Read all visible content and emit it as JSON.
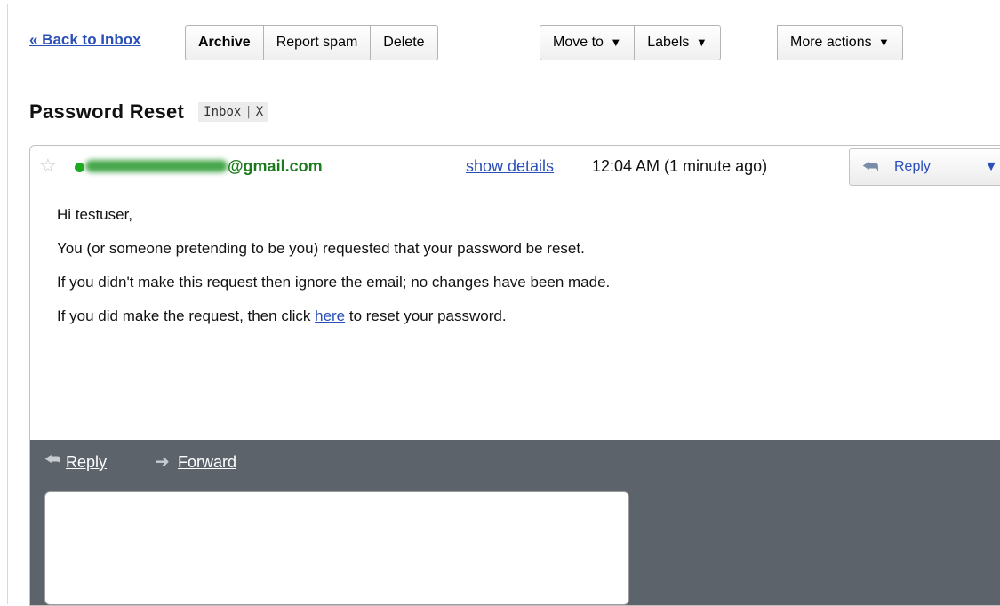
{
  "toolbar": {
    "back_label": "« Back to Inbox",
    "archive_label": "Archive",
    "report_spam_label": "Report spam",
    "delete_label": "Delete",
    "move_to_label": "Move to",
    "labels_label": "Labels",
    "more_actions_label": "More actions",
    "dropdown_glyph": "▼"
  },
  "thread": {
    "subject": "Password Reset",
    "label": "Inbox",
    "label_remove": "X"
  },
  "message": {
    "sender_visible": "@gmail.com",
    "show_details_label": "show details",
    "time": "12:04 AM (1 minute ago)",
    "reply_label": "Reply",
    "more_glyph": "▼",
    "body": {
      "greeting": "Hi testuser,",
      "line1": "You (or someone pretending to be you) requested that your password be reset.",
      "line2": "If you didn't make this request then ignore the email; no changes have been made.",
      "line3_before": "If you did make the request, then click ",
      "line3_link": "here",
      "line3_after": " to reset your password."
    }
  },
  "footer": {
    "reply_label": "Reply",
    "forward_label": "Forward"
  },
  "icons": {
    "star": "☆",
    "reply": "⮪",
    "forward": "➔"
  },
  "colors": {
    "link": "#2a4fb8",
    "sender": "#1c7a1c",
    "footer_bg": "#5c636b"
  }
}
